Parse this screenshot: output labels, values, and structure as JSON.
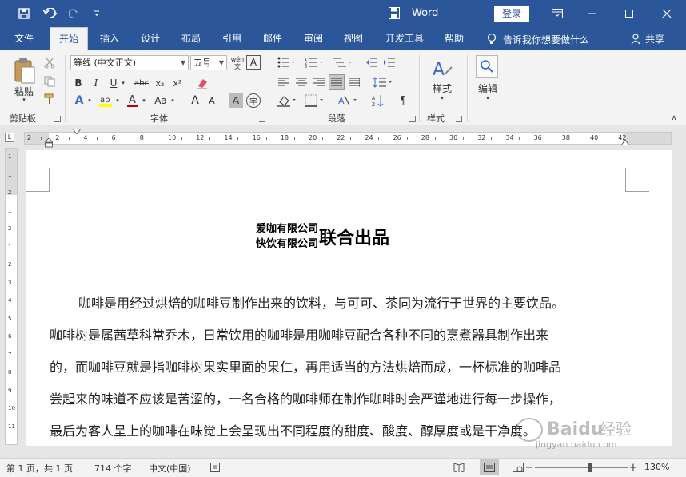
{
  "titlebar": {
    "app_title": "Word",
    "login_label": "登录",
    "bg_color": "#2b579a"
  },
  "tabs": [
    "文件",
    "开始",
    "插入",
    "设计",
    "布局",
    "引用",
    "邮件",
    "审阅",
    "视图",
    "开发工具",
    "帮助"
  ],
  "active_tab": "开始",
  "tell_me": "告诉我你想要做什么",
  "share_label": "共享",
  "ribbon": {
    "clipboard": {
      "paste_label": "粘贴",
      "group_label": "剪贴板"
    },
    "font": {
      "font_name": "等线 (中文正文)",
      "font_size": "五号",
      "group_label": "字体",
      "bold": "B",
      "italic": "I",
      "underline": "U",
      "strike": "abc",
      "subscript": "x₂",
      "superscript": "x²",
      "change_case": "Aa",
      "grow_font": "A",
      "shrink_font": "A",
      "char_shading": "A",
      "wen_label": "wén"
    },
    "paragraph": {
      "group_label": "段落"
    },
    "styles": {
      "label": "样式",
      "group_label": "样式"
    },
    "editing": {
      "label": "编辑"
    }
  },
  "ruler": {
    "h_numbers": [
      "2",
      "2",
      "4",
      "6",
      "8",
      "10",
      "12",
      "14",
      "16",
      "18",
      "20",
      "22",
      "24",
      "26",
      "28",
      "30",
      "32",
      "34",
      "36",
      "38",
      "40",
      "42"
    ],
    "corner": "L",
    "v_numbers": [
      "1",
      "1",
      "2",
      "1",
      "2",
      "1",
      "2",
      "3",
      "4",
      "5",
      "6",
      "7",
      "8",
      "9",
      "10",
      "11"
    ]
  },
  "document": {
    "heading_line1": "爱咖有限公司",
    "heading_line2": "快饮有限公司",
    "heading_big": "联合出品",
    "lines": [
      "咖啡是用经过烘焙的咖啡豆制作出来的饮料，与可可、茶同为流行于世界的主要饮品。",
      "咖啡树是属茜草科常乔木，日常饮用的咖啡是用咖啡豆配合各种不同的烹煮器具制作出来",
      "的，而咖啡豆就是指咖啡树果实里面的果仁，再用适当的方法烘焙而成，一杯标准的咖啡品",
      "尝起来的味道不应该是苦涩的，一名合格的咖啡师在制作咖啡时会严谨地进行每一步操作，",
      "最后为客人呈上的咖啡在味觉上会呈现出不同程度的甜度、酸度、醇厚度或是干净度。"
    ]
  },
  "statusbar": {
    "page_info": "第 1 页，共 1 页",
    "word_count": "714 个字",
    "language": "中文(中国)",
    "zoom_minus": "−",
    "zoom_plus": "+",
    "zoom": "130%"
  },
  "watermark": {
    "brand": "Baidu 经验",
    "url": "jingyan.baidu.com"
  }
}
